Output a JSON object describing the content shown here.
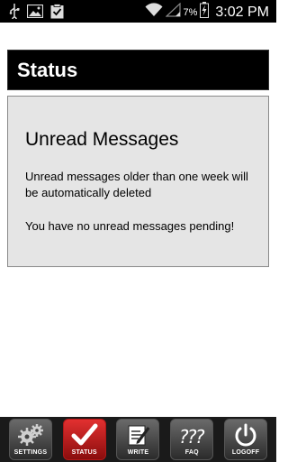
{
  "status_bar": {
    "battery_percent": "7%",
    "time": "3:02 PM"
  },
  "title_bar": {
    "title": "Status"
  },
  "panel": {
    "heading": "Unread Messages",
    "note": "Unread messages older than one week will be automatically deleted",
    "message": "You have no unread messages pending!"
  },
  "tabs": [
    {
      "label": "SETTINGS",
      "icon": "gears-icon",
      "active": false
    },
    {
      "label": "STATUS",
      "icon": "checkmark-icon",
      "active": true
    },
    {
      "label": "WRITE",
      "icon": "pencil-note-icon",
      "active": false
    },
    {
      "label": "FAQ",
      "icon": "question-marks-icon",
      "active": false
    },
    {
      "label": "LOGOFF",
      "icon": "power-icon",
      "active": false
    }
  ],
  "colors": {
    "active_tab": "#c81d1d",
    "panel_background": "#e5e5e5",
    "title_background": "#000000"
  }
}
